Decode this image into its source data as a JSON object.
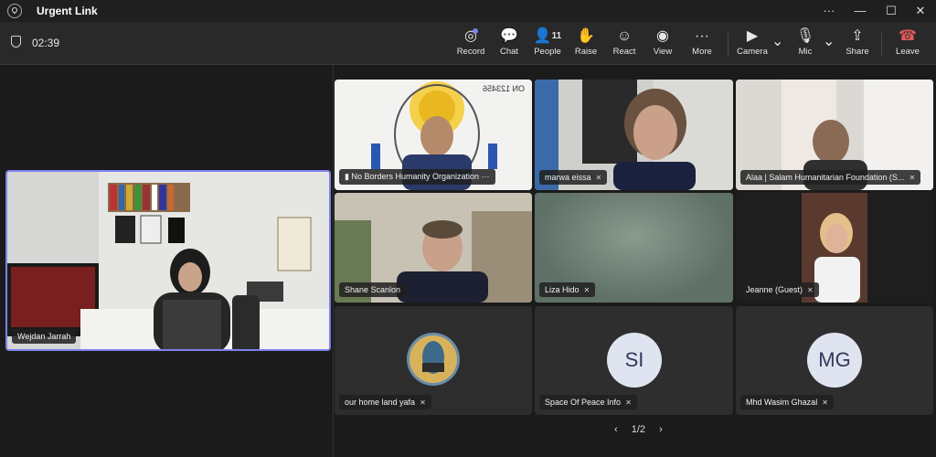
{
  "window": {
    "title": "Urgent Link",
    "more_label": "···",
    "minimize": "—",
    "maximize": "☐",
    "close": "✕"
  },
  "toolbar": {
    "timer": "02:39",
    "record": "Record",
    "chat": "Chat",
    "people": "People",
    "people_count": "11",
    "raise": "Raise",
    "react": "React",
    "view": "View",
    "more": "More",
    "camera": "Camera",
    "mic": "Mic",
    "share": "Share",
    "leave": "Leave",
    "leave_color": "#e05a5a"
  },
  "spotlight": {
    "name": "Wejdan Jarrah"
  },
  "participants": [
    {
      "name": "No Borders Humanity Organization",
      "dots": "···",
      "watermark": "ON 123456"
    },
    {
      "name": "marwa eissa"
    },
    {
      "name": "Alaa | Salam Humanitarian Foundation (S..."
    },
    {
      "name": "Shane Scanlon"
    },
    {
      "name": "Liza Hido"
    },
    {
      "name": "Jeanne (Guest)"
    },
    {
      "name": "our home land yafa"
    },
    {
      "name": "Space Of Peace Info",
      "initials": "SI"
    },
    {
      "name": "Mhd Wasim Ghazal",
      "initials": "MG"
    }
  ],
  "pager": {
    "prev": "‹",
    "label": "1/2",
    "next": "›"
  },
  "colors": {
    "accent": "#7b83eb",
    "background": "#1b1b1b",
    "toolbar": "#292929"
  }
}
